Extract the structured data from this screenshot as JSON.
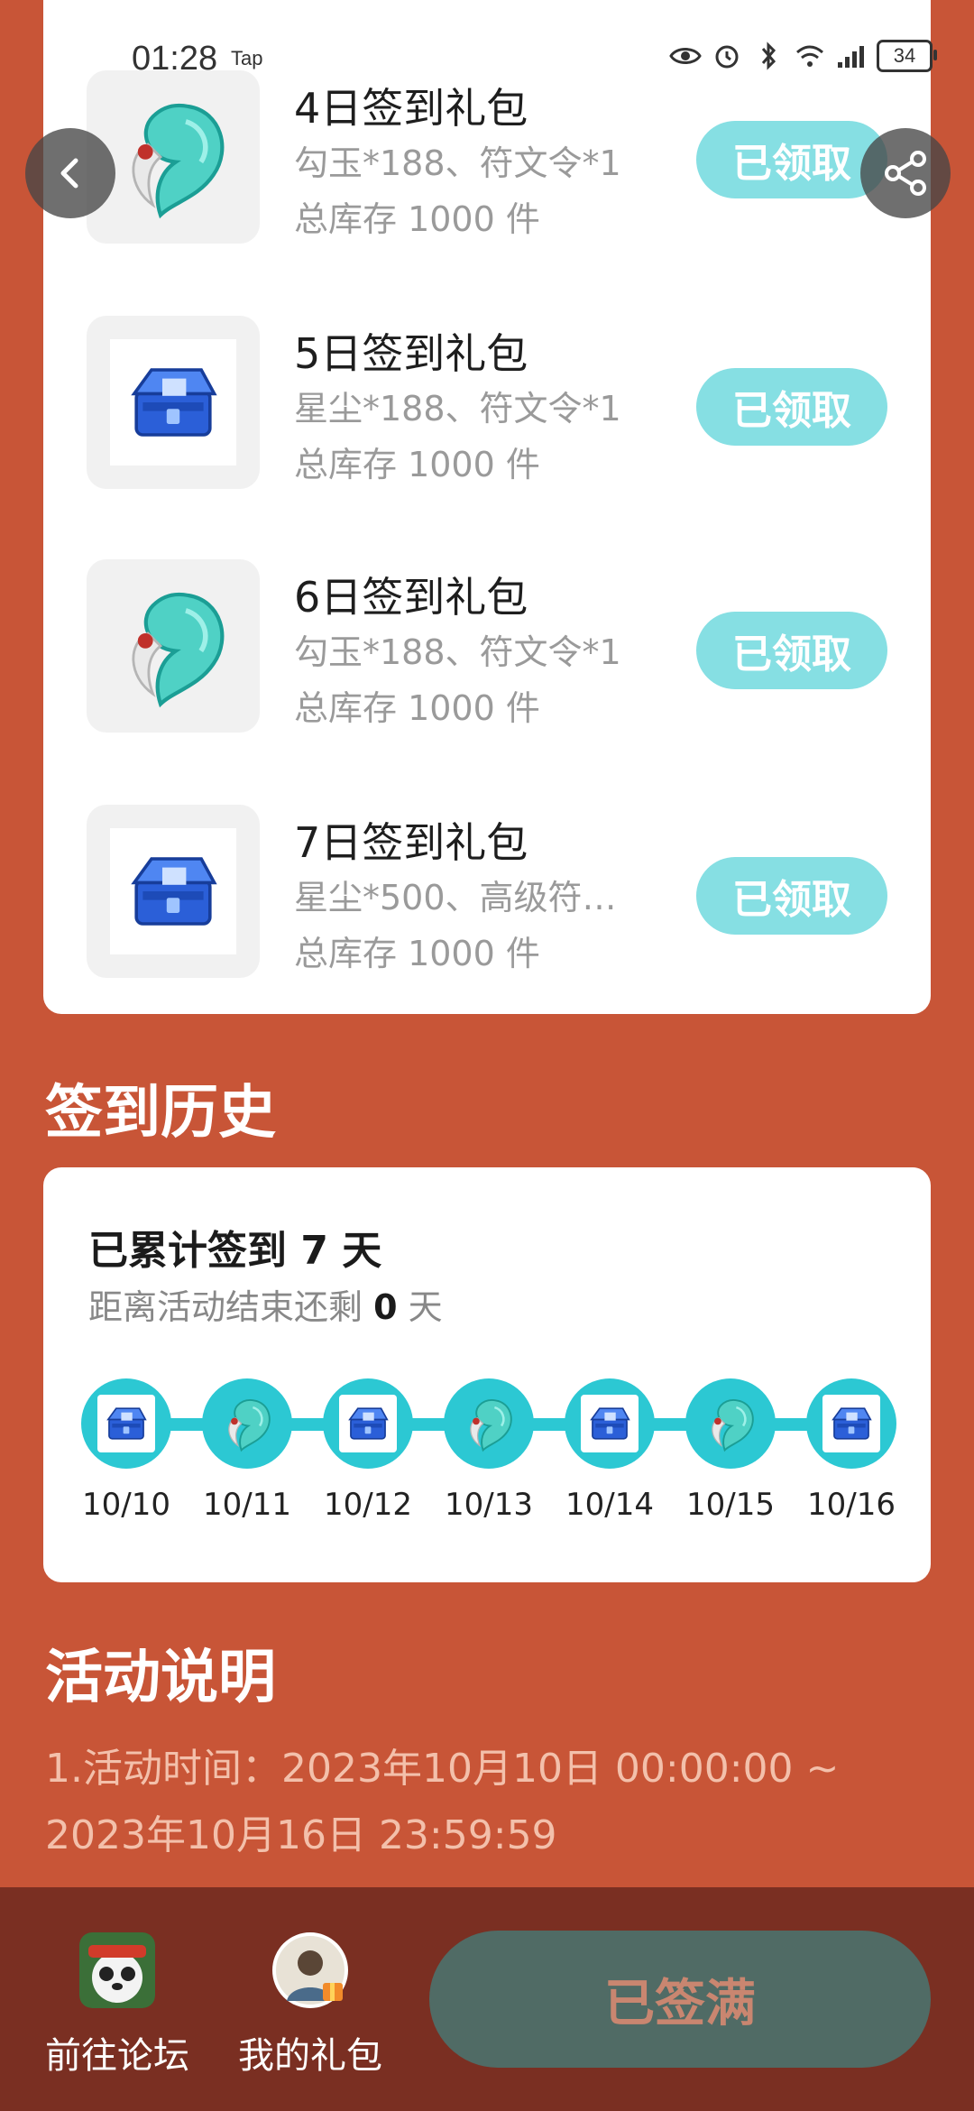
{
  "status_bar": {
    "time": "01:28",
    "carrier_badge": "Tap",
    "battery": "34"
  },
  "rewards": [
    {
      "title": "4日签到礼包",
      "items": "勾玉*188、符文令*1",
      "stock": "总库存 1000 件",
      "button": "已领取",
      "icon": "magatama-icon"
    },
    {
      "title": "5日签到礼包",
      "items": "星尘*188、符文令*1",
      "stock": "总库存 1000 件",
      "button": "已领取",
      "icon": "treasure-chest-icon"
    },
    {
      "title": "6日签到礼包",
      "items": "勾玉*188、符文令*1",
      "stock": "总库存 1000 件",
      "button": "已领取",
      "icon": "magatama-icon"
    },
    {
      "title": "7日签到礼包",
      "items": "星尘*500、高级符…",
      "stock": "总库存 1000 件",
      "button": "已领取",
      "icon": "treasure-chest-icon"
    }
  ],
  "history": {
    "title": "签到历史",
    "total_prefix": "已累计签到",
    "total_days": "7",
    "total_suffix": "天",
    "remain_prefix": "距离活动结束还剩",
    "remain_days": "0",
    "remain_suffix": "天",
    "days": [
      {
        "date": "10/10",
        "icon": "treasure-chest-icon"
      },
      {
        "date": "10/11",
        "icon": "magatama-icon"
      },
      {
        "date": "10/12",
        "icon": "treasure-chest-icon"
      },
      {
        "date": "10/13",
        "icon": "magatama-icon"
      },
      {
        "date": "10/14",
        "icon": "treasure-chest-icon"
      },
      {
        "date": "10/15",
        "icon": "magatama-icon"
      },
      {
        "date": "10/16",
        "icon": "treasure-chest-icon"
      }
    ]
  },
  "description": {
    "title": "活动说明",
    "line1": "1.活动时间：2023年10月10日 00:00:00 ~",
    "line2": "2023年10月16日 23:59:59"
  },
  "bottom_bar": {
    "forum_label": "前往论坛",
    "gifts_label": "我的礼包",
    "signed_button": "已签满"
  },
  "colors": {
    "background": "#c85537",
    "claimed_button": "#86dfe3",
    "timeline": "#2cc8d3",
    "bottom_bar": "#7a2f22",
    "signed_button": "#506b65"
  }
}
